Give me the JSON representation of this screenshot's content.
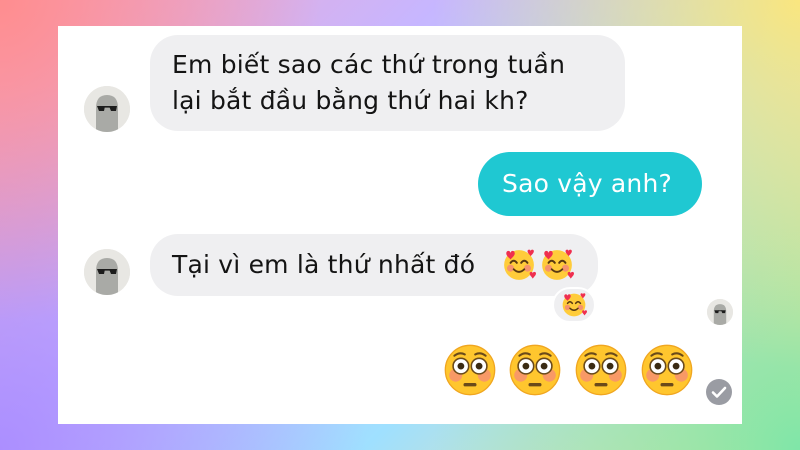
{
  "conversation": {
    "messages": [
      {
        "sender": "other",
        "lines": [
          "Em biết sao các thứ trong tuần",
          "lại bắt đầu bằng thứ hai kh?"
        ]
      },
      {
        "sender": "me",
        "text": "Sao vậy anh?"
      },
      {
        "sender": "other",
        "text": "Tại vì em là thứ nhất đó",
        "emojis": [
          "smiling-face-with-hearts-emoji",
          "smiling-face-with-hearts-emoji"
        ],
        "reaction": "smiling-face-with-hearts-emoji"
      },
      {
        "sender": "me",
        "emojis": [
          "flushed-face-emoji",
          "flushed-face-emoji",
          "flushed-face-emoji",
          "flushed-face-emoji"
        ]
      }
    ]
  },
  "status": {
    "read_receipt": "avatar-icon",
    "sent_icon": "check-circle-icon"
  },
  "colors": {
    "incoming_bubble": "#efeff1",
    "outgoing_bubble": "#1fc8d2",
    "outgoing_text": "#ffffff",
    "incoming_text": "#141414",
    "panel": "#ffffff"
  }
}
